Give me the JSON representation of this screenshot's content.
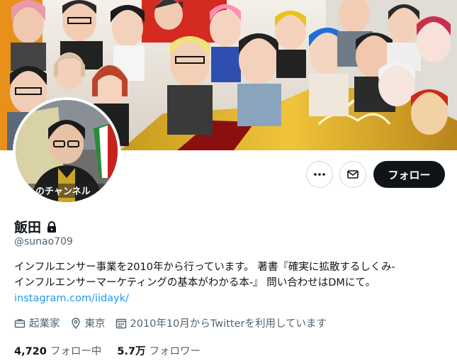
{
  "profile": {
    "name": "飯田",
    "handle": "@sunao709",
    "bio_line1": "インフルエンサー事業を2010年から行っています。 著書『確実に拡散するしくみ-",
    "bio_line2": "インフルエンサーマーケティングの基本がわかる本-』 問い合わせはDMにて。",
    "link": "instagram.com/iidayk/",
    "occupation": "起業家",
    "location": "東京",
    "joined": "2010年10月からTwitterを利用しています",
    "following_count": "4,720",
    "following_label": "フォロー中",
    "followers_count": "5.7万",
    "followers_label": "フォロワー",
    "avatar_caption": "のチャンネル"
  },
  "actions": {
    "more_icon": "more-dots-icon",
    "dm_icon": "envelope-icon",
    "follow_label": "フォロー"
  },
  "colors": {
    "accent": "#1d9bf0",
    "follow_bg": "#0f1419",
    "muted": "#536471"
  }
}
